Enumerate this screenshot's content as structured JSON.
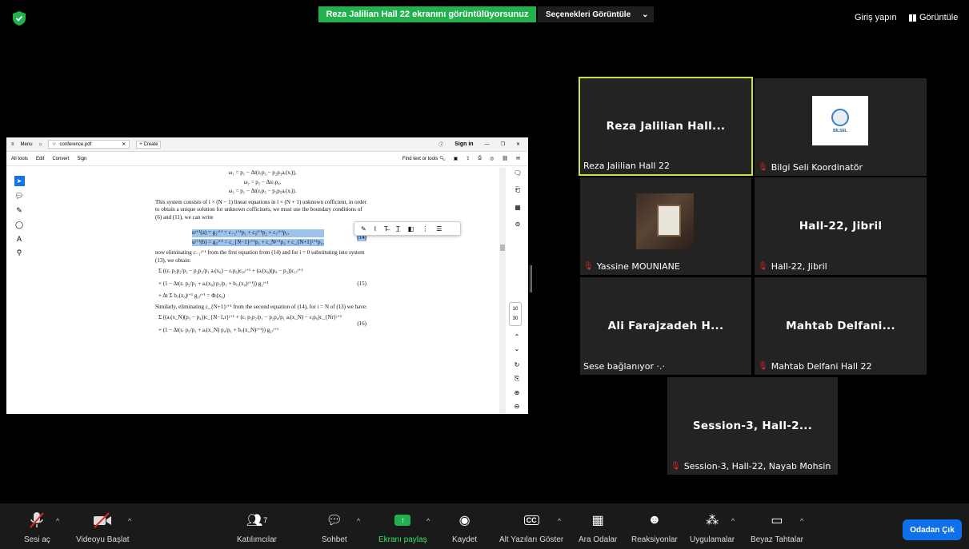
{
  "top": {
    "share_banner": "Reza Jalilian Hall 22 ekranını görüntülüyorsunuz",
    "view_options": "Seçenekleri Görüntüle",
    "sign_in": "Giriş yapın",
    "view": "Görüntüle"
  },
  "pdf": {
    "menu": "Menu",
    "tab_title": "conference.pdf",
    "create": "Create",
    "sign_in": "Sign in",
    "toolbar": [
      "All tools",
      "Edit",
      "Convert",
      "Sign"
    ],
    "find": "Find text or tools",
    "page_current": "10",
    "page_total": "30",
    "text": {
      "l1": "ω₁ = p₁ − Δt(εᵣp₅ − p₂p₃aᵣ(xᵢ)),",
      "l2": "ω₂ = p₂ − Δtεᵣp₆,",
      "l3": "ω₃ = p₁ − Δt(εᵣp₅ − p₃p₅aᵣ(xᵢ)).",
      "para1": "This system consists of l × (N − 1) linear equations in l × (N + 1) unknown cofficient, in order to obtain a unique solution for unknown cofficinets, we must use the boundary conditions of (6) and (11), we can write",
      "eq14a": "uʲ⁺¹(a) = g₁ʲ⁺¹ = c₋₁ʲ⁺¹p₁ + c₀ʲ⁺¹p₂ + c₁ʲ⁺¹p₁,",
      "eq14b": "uʲ⁺¹(b) = g₂ʲ⁺¹ = c_{N−1}ʲ⁺¹p₁ + c_Nʲ⁺¹p₂ + c_{N+1}ʲ⁺¹p₁,",
      "n14": "(14)",
      "para2": "now eliminating c₋₁ʲ⁺¹ from the first equation from (14) and for i = 0 substituting into system (13), we obtain:",
      "eq15a": "Σ ((εᵣ p₅p₂/p₁ − p₂p₃/p₁ aᵣ(x₀) − εᵣp₆)c₀ᵣʲ⁺¹ + (aᵣ(x₀)(p₄ − p₃))c₁ᵣʲ⁺¹",
      "eq15b": "+ (1 − Δt(εᵣ p₅/p₁ + aᵣ(x₀) p₃/p₁ + bᵣ₁(x₀)ʲ⁺¹)) g₁ʲ⁺¹",
      "n15": "(15)",
      "eq15c": "+ Δt Σ bᵣᵢ(x₀)ʲ⁺¹ g₁ᵢʲ⁺¹ = Φᵢ(x₀)",
      "para3": "Similarly, eliminating c_{N+1}ʲ⁺¹ from the second equation of (14), for i = N of (13) we have:",
      "eq16a": "Σ ((aᵣ(x_N)(p₃ − p₄))c_{N−1,r}ʲ⁺¹ + (εᵣ p₅p₂/p₁ − p₂p₄/p₁ aᵣ(x_N) − εᵣp₆)c_{Nr}ʲ⁺¹",
      "eq16b": "+ (1 − Δt(εᵣ p₅/p₁ + aᵣ(x_N) p₄/p₁ + bᵣᵢ(x_N)ʲ⁺¹)) g₂ᵣʲ⁺¹",
      "n16": "(16)"
    }
  },
  "participants": [
    {
      "name": "Reza Jalilian Hall...",
      "label": "Reza Jalilian Hall 22",
      "muted": false
    },
    {
      "name": "",
      "label": "Bilgi Seli Koordinatör",
      "muted": true,
      "logo_text": "BİLSEL"
    },
    {
      "name": "",
      "label": "Yassine MOUNIANE",
      "muted": true
    },
    {
      "name": "Hall-22, Jibril",
      "label": "Hall-22, Jibril",
      "muted": true
    },
    {
      "name": "Ali Farajzadeh H...",
      "label": "Sese bağlanıyor ·.·",
      "muted": false
    },
    {
      "name": "Mahtab Delfani...",
      "label": "Mahtab Delfani Hall 22",
      "muted": true
    },
    {
      "name": "Session-3, Hall-2...",
      "label": "Session-3, Hall-22, Nayab Mohsin",
      "muted": true
    }
  ],
  "bar": {
    "mute": "Sesi aç",
    "video": "Videoyu Başlat",
    "participants": "Katılımcılar",
    "participant_count": "7",
    "chat": "Sohbet",
    "share": "Ekranı paylaş",
    "record": "Kaydet",
    "captions": "Alt Yazıları Göster",
    "breakout": "Ara Odalar",
    "reactions": "Reaksiyonlar",
    "apps": "Uygulamalar",
    "whiteboard": "Beyaz Tahtalar",
    "leave": "Odadan Çık"
  }
}
